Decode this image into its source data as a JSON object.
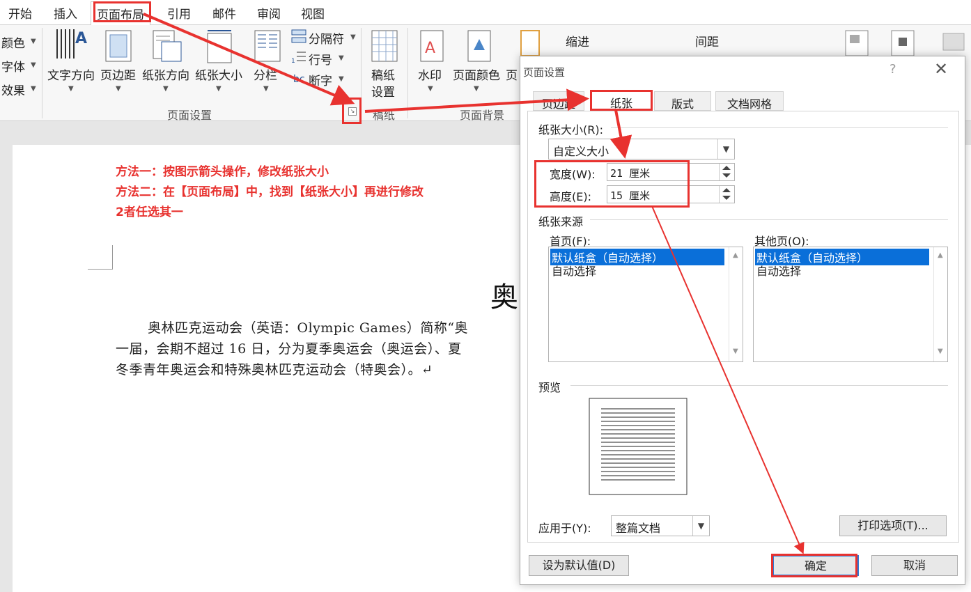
{
  "ribbon_tabs": [
    "开始",
    "插入",
    "页面布局",
    "引用",
    "邮件",
    "审阅",
    "视图"
  ],
  "ribbon": {
    "left_items": [
      "颜色",
      "字体",
      "效果"
    ],
    "page_setup_buttons": [
      "文字方向",
      "页边距",
      "纸张方向",
      "纸张大小",
      "分栏"
    ],
    "small_items": [
      "分隔符",
      "行号",
      "断字"
    ],
    "gaozhi_button": [
      "稿纸",
      "设置"
    ],
    "watermark": "水印",
    "page_color": "页面颜色",
    "page_border": "页",
    "indent_label": "缩进",
    "spacing_label": "间距",
    "group_page_setup": "页面设置",
    "group_gaozhi": "稿纸",
    "group_page_bg": "页面背景"
  },
  "notes": [
    "方法一：按图示箭头操作，修改纸张大小",
    "方法二：在【页面布局】中，找到【纸张大小】再进行修改",
    "2者任选其一"
  ],
  "document": {
    "title_char": "奥",
    "line1": "奥林匹克运动会（英语：Olympic Games）简称“奥",
    "line2": "一届，会期不超过 16 日，分为夏季奥运会（奥运会）、夏",
    "line3": "冬季青年奥运会和特殊奥林匹克运动会（特奥会）。↵"
  },
  "dialog": {
    "title": "页面设置",
    "help": "?",
    "close": "✕",
    "tabs": [
      "页边距",
      "纸张",
      "版式",
      "文档网格"
    ],
    "paper_size_label": "纸张大小(R):",
    "paper_size_value": "自定义大小",
    "width_label": "宽度(W):",
    "width_value": "21 厘米",
    "height_label": "高度(E):",
    "height_value": "15 厘米",
    "paper_source_label": "纸张来源",
    "first_page_label": "首页(F):",
    "other_pages_label": "其他页(O):",
    "tray_options": [
      "默认纸盒（自动选择）",
      "自动选择"
    ],
    "preview_label": "预览",
    "apply_to_label": "应用于(Y):",
    "apply_to_value": "整篇文档",
    "print_options_button": "打印选项(T)...",
    "set_default_button": "设为默认值(D)",
    "ok_button": "确定",
    "cancel_button": "取消"
  },
  "colors": {
    "annotation_red": "#e8322f",
    "selection_blue": "#0a6fd9"
  }
}
